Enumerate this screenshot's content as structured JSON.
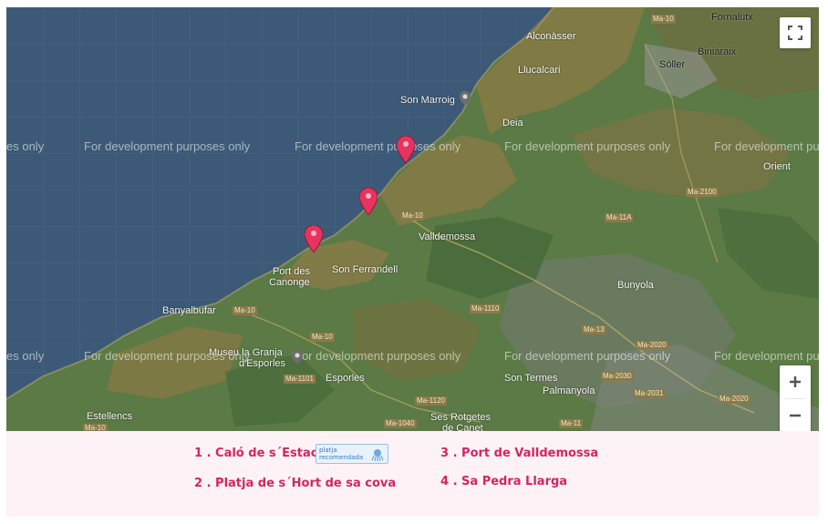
{
  "map": {
    "watermark_text": "For development purposes only",
    "watermark_partial": "es only",
    "places": {
      "fornalutx": "Fornalutx",
      "biniaraix": "Biniaraix",
      "alconasser": "Alconàsser",
      "llucalcari": "Llucalcari",
      "soller": "Sóller",
      "son_marroig": "Son Marroig",
      "deia": "Deia",
      "orient": "Orient",
      "valldemossa": "Valldemossa",
      "port_des": "Port des",
      "canonge": "Canonge",
      "son_ferrandell": "Son Ferrandell",
      "bunyola": "Bunyola",
      "banyalbufar": "Banyalbufar",
      "museu": "Museu la Granja",
      "desporles": "d'Esporles",
      "esporles": "Esporles",
      "son_termes": "Son Termes",
      "palmanyola": "Palmanyola",
      "estellencs": "Estellencs",
      "ses_rotgetes": "Ses Rotgetes",
      "de_canet": "de Canet"
    },
    "roads": {
      "r1": "Ma-10",
      "r2": "Ma-2100",
      "r3": "Ma-10",
      "r4": "Ma-11A",
      "r5": "Ma-1110",
      "r6": "Ma-10",
      "r7": "Ma-10",
      "r8": "Ma-13",
      "r9": "Ma-2020",
      "r10": "Ma-1101",
      "r11": "Ma-2030",
      "r12": "Ma-1120",
      "r13": "Ma-2031",
      "r14": "Ma-2020",
      "r15": "Ma-1040",
      "r16": "Ma-11",
      "r17": "Ma-10"
    },
    "marker_color": "#e8335f",
    "water_color": "#3c5a77",
    "fullscreen_icon": "fullscreen-icon",
    "zoom_in_icon": "plus-icon",
    "zoom_out_icon": "minus-icon"
  },
  "legend": {
    "item1": "1 . Caló de s´Estaca",
    "item2": "2 . Platja de s´Hort de sa cova",
    "item3": "3 . Port de Valldemossa",
    "item4": "4 . Sa Pedra Llarga",
    "badge_line1": "platja",
    "badge_line2": "recomendada",
    "accent_color": "#d6245f"
  }
}
